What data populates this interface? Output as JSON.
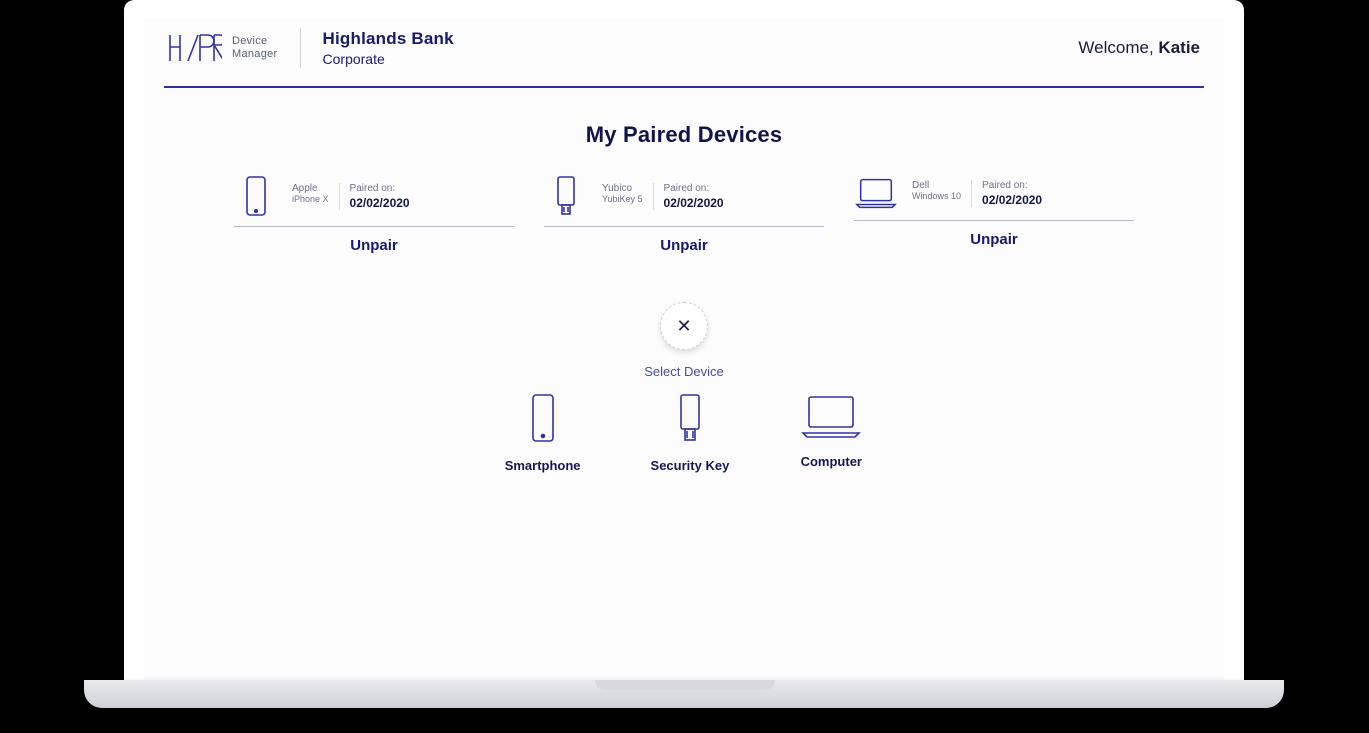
{
  "header": {
    "product_line1": "Device",
    "product_line2": "Manager",
    "org_name": "Highlands Bank",
    "org_sub": "Corporate",
    "welcome_prefix": "Welcome, ",
    "welcome_name": "Katie"
  },
  "page": {
    "title": "My Paired Devices"
  },
  "devices": [
    {
      "brand": "Apple",
      "model": "iPhone X",
      "paired_label": "Paired on:",
      "paired_date": "02/02/2020",
      "action": "Unpair",
      "icon": "smartphone"
    },
    {
      "brand": "Yubico",
      "model": "YubiKey 5",
      "paired_label": "Paired on:",
      "paired_date": "02/02/2020",
      "action": "Unpair",
      "icon": "securitykey"
    },
    {
      "brand": "Dell",
      "model": "Windows 10",
      "paired_label": "Paired on:",
      "paired_date": "02/02/2020",
      "action": "Unpair",
      "icon": "laptop"
    }
  ],
  "selector": {
    "close_glyph": "✕",
    "label": "Select Device",
    "options": [
      {
        "caption": "Smartphone",
        "icon": "smartphone"
      },
      {
        "caption": "Security Key",
        "icon": "securitykey"
      },
      {
        "caption": "Computer",
        "icon": "laptop"
      }
    ]
  }
}
